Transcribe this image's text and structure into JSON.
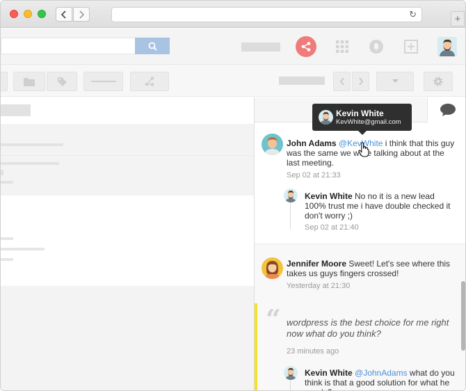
{
  "browser": {
    "url": "",
    "icons": {
      "back": "chevron-left-icon",
      "forward": "chevron-right-icon",
      "reload": "reload-icon",
      "new_tab": "plus-icon"
    }
  },
  "app": {
    "topbar_icons": [
      "search-icon",
      "share-icon",
      "grid-icon",
      "bell-icon",
      "add-box-icon",
      "user-avatar"
    ],
    "toolbar_icons": [
      "folder-icon",
      "tag-icon",
      "share-icon",
      "chevron-left-icon",
      "chevron-right-icon",
      "caret-down-icon",
      "gear-icon"
    ]
  },
  "tooltip": {
    "name": "Kevin White",
    "email": "KevWhite@gmail.com"
  },
  "comments": [
    {
      "author": "John Adams",
      "mention": "@KevWhite",
      "text": " i think that this guy was the same we were talking about at the last meeting.",
      "time": "Sep 02 at 21:33",
      "reply": {
        "author": "Kevin White",
        "text": " No no it is a new lead 100% trust me i have double checked it don't worry ;)",
        "time": "Sep 02 at 21:40"
      }
    },
    {
      "author": "Jennifer Moore",
      "text": " Sweet! Let's see where this takes us guys fingers crossed!",
      "time": "Yesterday at 21:30"
    }
  ],
  "quote": {
    "text": "wordpress is the best choice for me right now what do you think?",
    "time": "23 minutes ago",
    "reply": {
      "author": "Kevin White",
      "mention": "@JohnAdams",
      "text": " what do you think is that a good solution for what he needs?"
    }
  },
  "colors": {
    "accent_blue": "#4a90d9",
    "share_red": "#ef7b7b",
    "quote_yellow": "#f5e12b",
    "search_blue": "#a9c3e2"
  }
}
